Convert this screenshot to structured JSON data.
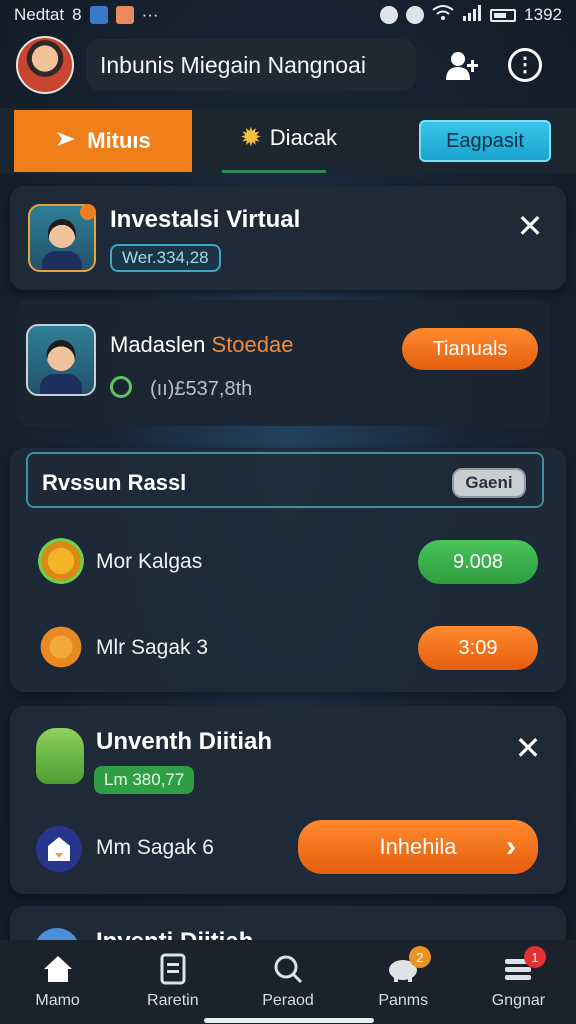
{
  "status_bar": {
    "carrier": "Nedtat",
    "carrier_num": "8",
    "time": "1392"
  },
  "header": {
    "title": "Inbunis Miegain Nangnoai"
  },
  "tabs": {
    "tab1": "Mituıs",
    "tab2": "Diacak",
    "tab_button": "Eagpasit"
  },
  "card1": {
    "title": "Investalsi Virtual",
    "tag": "Wer.334,28",
    "user_name_part1": "Madaslen",
    "user_name_part2": "Stoedae",
    "amount": "(ıı)£537,8th",
    "action_button": "Tianuals"
  },
  "section": {
    "title": "Rvssun Rassl",
    "badge": "Gaeni",
    "rows": [
      {
        "label": "Mor Kalgas",
        "value": "9.008"
      },
      {
        "label": "Mlr Sagak 3",
        "value": "3:09"
      }
    ]
  },
  "card2": {
    "title": "Unventh Diitiah",
    "tag": "Lm 380,77",
    "row_label": "Mm Sagak 6",
    "action_button": "Inhehila"
  },
  "card3": {
    "title_partial": "Inventi Diitiah"
  },
  "bottom_nav": [
    {
      "label": "Mamo",
      "icon": "home-icon"
    },
    {
      "label": "Raretin",
      "icon": "document-icon"
    },
    {
      "label": "Peraod",
      "icon": "search-icon"
    },
    {
      "label": "Panms",
      "icon": "piggy-bank-icon",
      "badge": "2"
    },
    {
      "label": "Gngnar",
      "icon": "stack-icon",
      "badge": "1"
    }
  ],
  "colors": {
    "accent_orange": "#f07f1a",
    "accent_green": "#3db04f",
    "accent_cyan": "#2ab6de",
    "background": "#172434"
  }
}
